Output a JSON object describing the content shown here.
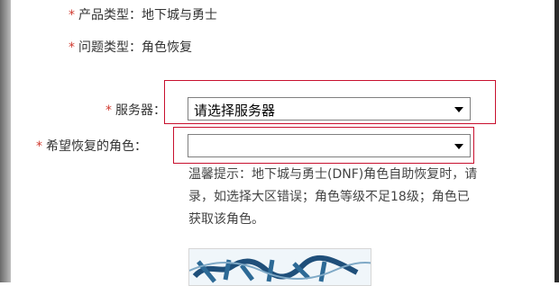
{
  "form": {
    "product_type": {
      "label": "产品类型：",
      "value": "地下城与勇士"
    },
    "issue_type": {
      "label": "问题类型：",
      "value": "角色恢复"
    },
    "server": {
      "label": "服务器：",
      "selected": "请选择服务器"
    },
    "role": {
      "label": "希望恢复的角色：",
      "selected": ""
    },
    "required_mark": "*"
  },
  "tips": {
    "line1": "温馨提示：地下城与勇士(DNF)角色自助恢复时，请",
    "line2": "录，如选择大区错误；角色等级不足18级；角色已",
    "line3": "获取该角色。"
  },
  "colors": {
    "required": "#d03a2f",
    "highlight_box": "#c8102e"
  }
}
